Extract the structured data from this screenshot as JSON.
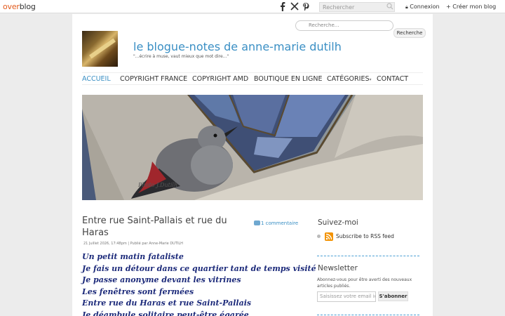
{
  "topbar": {
    "logo_prefix": "over",
    "logo_suffix": "blog",
    "social_icons": [
      "facebook-icon",
      "x-icon",
      "pinterest-icon"
    ],
    "search_placeholder": "Rechercher",
    "login_label": "Connexion",
    "create_blog_label": "Créer mon blog"
  },
  "header": {
    "search_placeholder": "Recherche...",
    "search_button": "Recherche",
    "title": "le blogue-notes de anne-marie dutilh",
    "subtitle": "\"...écrire à muse, vaut mieux que mot dire...\""
  },
  "nav": {
    "items": [
      {
        "label": "ACCUEIL"
      },
      {
        "label": "COPYRIGHT FRANCE"
      },
      {
        "label": "COPYRIGHT AMD"
      },
      {
        "label": "BOUTIQUE EN LIGNE"
      },
      {
        "label": "CATÉGORIES"
      },
      {
        "label": "CONTACT"
      }
    ],
    "active_index": 0,
    "dropdown_marker": "▾"
  },
  "banner": {
    "caption": "Photo J.Dutilh"
  },
  "post": {
    "title": "Entre rue Saint-Pallais et rue du Haras",
    "comments": "1 commentaire",
    "meta": "21 Juillet 2026, 17:48pm | Publié par Anne-Marie DUTILH",
    "lines": [
      "Un petit matin fataliste",
      "Je fais un détour dans ce quartier tant de temps visité",
      "Je passe anonyme devant les vitrines",
      "Les fenêtres sont fermées",
      "Entre rue du Haras et rue Saint-Pallais",
      "Je déambule solitaire peut-être égarée"
    ]
  },
  "sidebar": {
    "follow_title": "Suivez-moi",
    "rss_label": "Subscribe to RSS feed",
    "newsletter_title": "Newsletter",
    "newsletter_desc": "Abonnez-vous pour être averti des nouveaux articles publiés.",
    "newsletter_placeholder": "Saisissez votre email ici",
    "newsletter_button": "S'abonner"
  },
  "colors": {
    "accent": "#3a8fc4",
    "overblog_orange": "#e25a1c",
    "poem_text": "#1c2a7a",
    "rss_orange": "#f39200"
  }
}
